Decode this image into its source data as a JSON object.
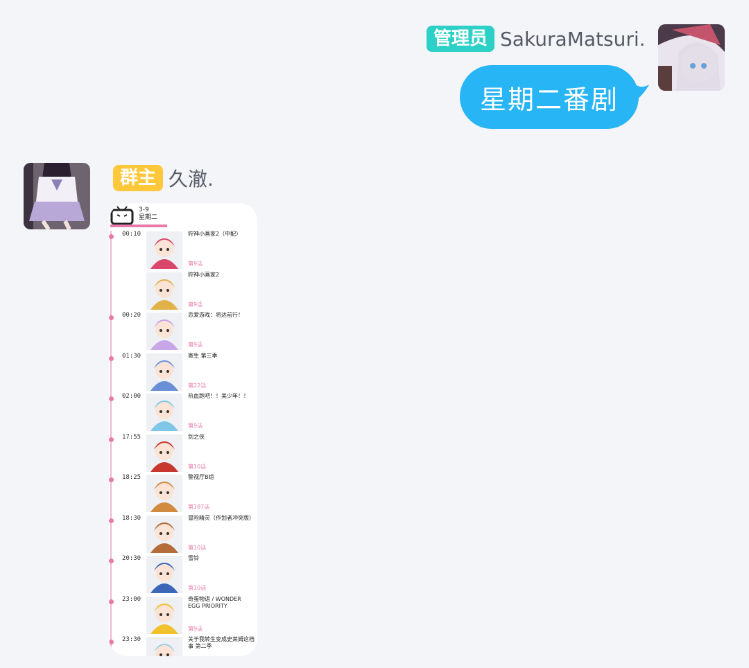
{
  "messages": [
    {
      "badge": "管理员",
      "badge_color": "#2dd0c6",
      "sender": "SakuraMatsuri.",
      "text": "星期二番剧",
      "bubble_color": "#27b5f5",
      "avatar": "anime-girl-avatar-white-hair"
    },
    {
      "badge": "群主",
      "badge_color": "#ffc83a",
      "sender": "久澈.",
      "avatar": "anime-girl-avatar-school-uniform",
      "image": {
        "header_date": "3-9",
        "header_day": "星期二",
        "accent_color": "#e77aa8",
        "entries": [
          {
            "time": "00:10",
            "title": "狩神小画家2（中配）",
            "episode": "第9话",
            "thumb_color": "#d9466a"
          },
          {
            "time": "",
            "title": "狩神小画家2",
            "episode": "第9话",
            "thumb_color": "#e2b24a"
          },
          {
            "time": "00:20",
            "title": "恋爱游戏：将达前行！",
            "episode": "第9话",
            "thumb_color": "#c9a6e8"
          },
          {
            "time": "01:30",
            "title": "寄生 第三季",
            "episode": "第22话",
            "thumb_color": "#6a8fd6"
          },
          {
            "time": "02:00",
            "title": "热血跑吧！！美少年！！",
            "episode": "第9话",
            "thumb_color": "#7fc7e6"
          },
          {
            "time": "17:55",
            "title": "剑之侠",
            "episode": "第10话",
            "thumb_color": "#c8372f"
          },
          {
            "time": "18:25",
            "title": "警视厅B组",
            "episode": "第187话",
            "thumb_color": "#d28b3e"
          },
          {
            "time": "18:30",
            "title": "冒险精灵（作划者冲突版）",
            "episode": "第10话",
            "thumb_color": "#b46c3a"
          },
          {
            "time": "20:30",
            "title": "雪铃",
            "episode": "第10话",
            "thumb_color": "#3e66b8"
          },
          {
            "time": "23:00",
            "title": "奇蛋物语 / WONDER EGG PRIORITY",
            "episode": "第9话",
            "thumb_color": "#f2c12e"
          },
          {
            "time": "23:30",
            "title": "关于我转生变成史莱姆这档事 第二季",
            "episode": "",
            "thumb_color": "#9ad0ea"
          }
        ]
      }
    }
  ]
}
